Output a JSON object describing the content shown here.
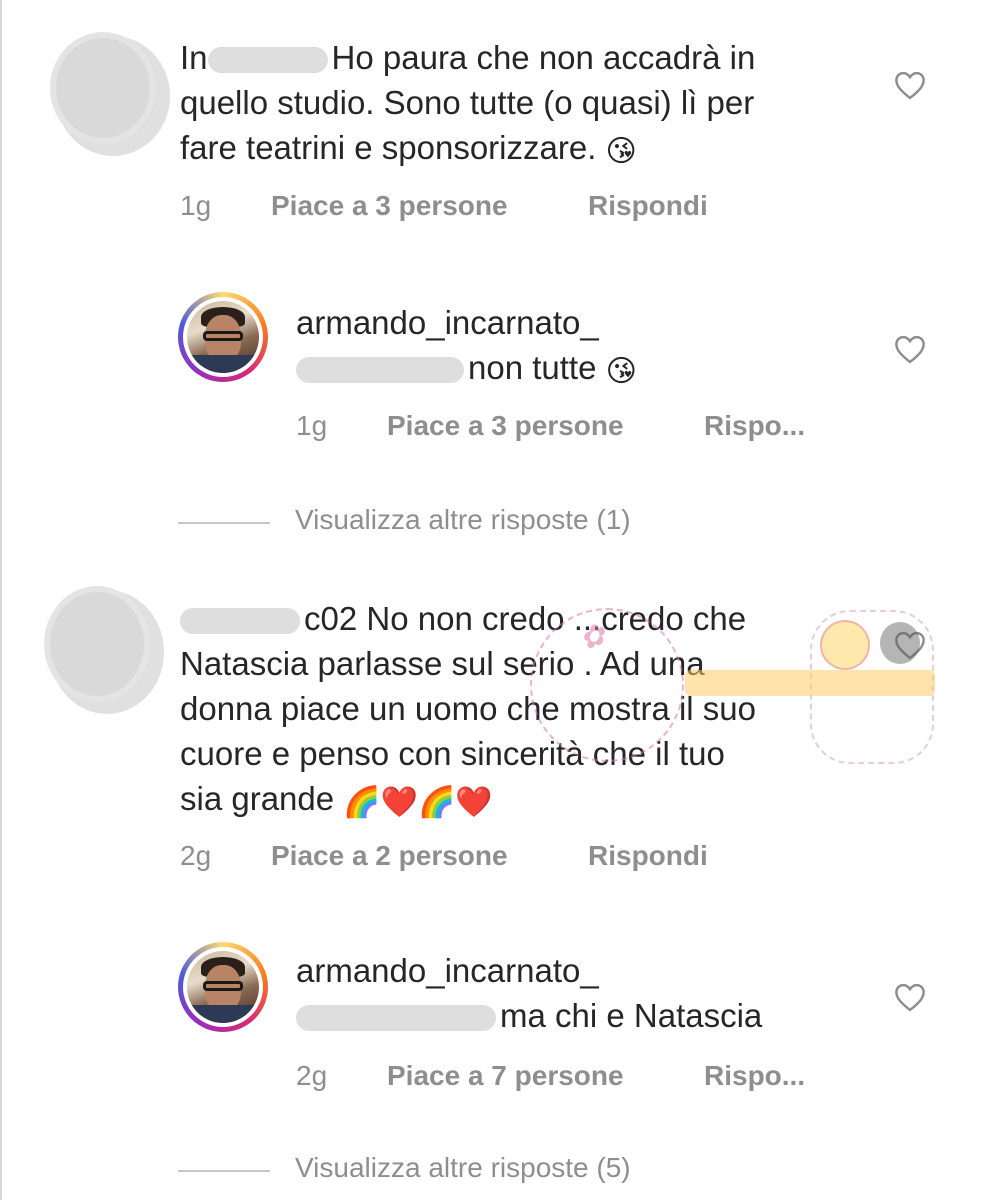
{
  "comments": [
    {
      "username": "In",
      "text_line1": "Ho paura che non accadrà in",
      "text_line2": "quello studio. Sono tutte (o quasi) lì per",
      "text_line3": "fare teatrini e sponsorizzare.",
      "emoji": "😘",
      "time": "1g",
      "likes": "Piace a 3 persone",
      "reply": "Rispondi"
    },
    {
      "username": "armando_incarnato_",
      "text_line1": "non tutte",
      "emoji": "😘",
      "time": "1g",
      "likes": "Piace a 3 persone",
      "reply": "Rispo..."
    },
    {
      "view_more": "Visualizza altre risposte (1)"
    },
    {
      "username": "c02",
      "text_line1": "No non credo ...credo che",
      "text_line2": "Natascia parlasse sul serio . Ad una",
      "text_line3": "donna piace un uomo che mostra il suo",
      "text_line4": "cuore e penso con sincerità che il tuo",
      "text_line5": "sia grande",
      "emoji": "🌈❤️🌈❤️",
      "time": "2g",
      "likes": "Piace a 2 persone",
      "reply": "Rispondi"
    },
    {
      "username": "armando_incarnato_",
      "text_line1": "ma chi e Natascia",
      "time": "2g",
      "likes": "Piace a 7 persone",
      "reply": "Rispo..."
    },
    {
      "view_more": "Visualizza altre risposte (5)"
    }
  ],
  "icons": {
    "heart": "heart-outline-icon"
  },
  "colors": {
    "text": "#262626",
    "meta": "#8e8e8e",
    "divider": "#c7c7c7"
  }
}
